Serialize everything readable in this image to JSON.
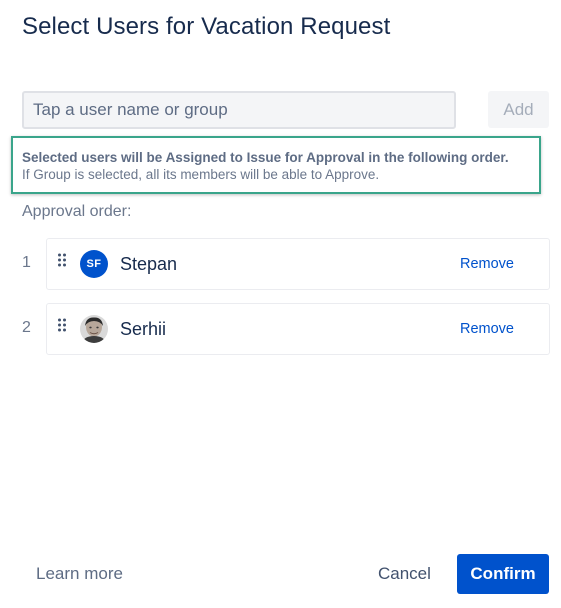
{
  "dialog": {
    "title": "Select Users for Vacation Request"
  },
  "search": {
    "placeholder": "Tap a user name or group",
    "value": ""
  },
  "add_button": {
    "label": "Add",
    "enabled": false
  },
  "info": {
    "line1": "Selected users will be Assigned to Issue for Approval in the following order.",
    "line2": "If Group is selected, all its members will be able to Approve."
  },
  "approval_order": {
    "label": "Approval order:",
    "approvers": [
      {
        "order": "1",
        "name": "Stepan",
        "avatar_initials": "SF",
        "avatar_type": "initials",
        "remove_label": "Remove"
      },
      {
        "order": "2",
        "name": "Serhii",
        "avatar_type": "photo",
        "remove_label": "Remove"
      }
    ]
  },
  "footer": {
    "learn_more_label": "Learn more",
    "cancel_label": "Cancel",
    "confirm_label": "Confirm"
  },
  "colors": {
    "primary": "#0052cc",
    "highlight_border": "#3aa58b",
    "text_dark": "#172b4d",
    "text_subtle": "#6b778c"
  },
  "icons": {
    "drag_handle": "drag-handle-icon"
  }
}
